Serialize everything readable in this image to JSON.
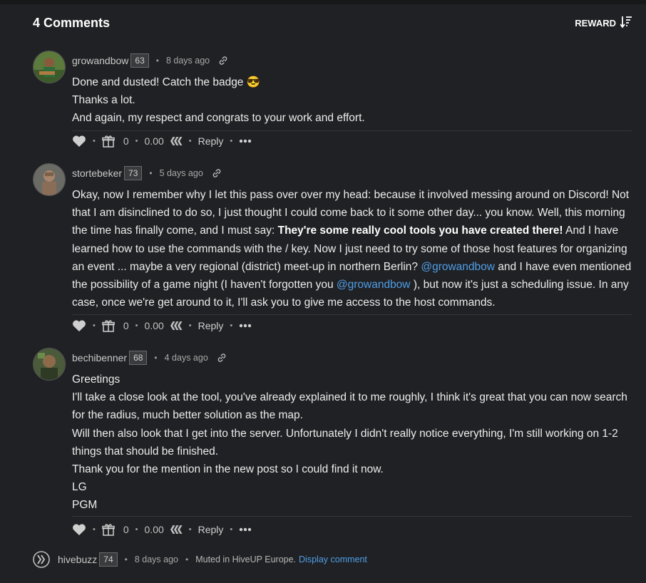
{
  "header": {
    "title": "4 Comments",
    "reward_label": "REWARD"
  },
  "comments": [
    {
      "author": "growandbow",
      "reputation": "63",
      "time": "8 days ago",
      "lines": [
        "Done and dusted! Catch the badge 😎",
        "Thanks a lot.",
        "And again, my respect and congrats to your work and effort."
      ],
      "votes": "0",
      "payout": "0.00",
      "reply": "Reply"
    },
    {
      "author": "stortebeker",
      "reputation": "73",
      "time": "5 days ago",
      "text": {
        "p1": "Okay, now I remember why I let this pass over over my head: because it involved messing around on Discord! Not that I am disinclined to do so, I just thought I could come back to it some other day... you know. Well, this morning the time has finally come, and I must say: ",
        "bold": "They're some really cool tools you have created there!",
        "p2": " And I have learned how to use the commands with the / key. Now I just need to try some of those host features for organizing an event ... maybe a very regional (district) meet-up in northern Berlin? ",
        "mention1": "@growandbow",
        "p3": " and I have even mentioned the possibility of a game night (I haven't forgotten you ",
        "mention2": "@growandbow",
        "p4": " ), but now it's just a scheduling issue. In any case, once we're get around to it, I'll ask you to give me access to the host commands."
      },
      "votes": "0",
      "payout": "0.00",
      "reply": "Reply"
    },
    {
      "author": "bechibenner",
      "reputation": "68",
      "time": "4 days ago",
      "lines": [
        "Greetings",
        "I'll take a close look at the tool, you've already explained it to me roughly, I think it's great that you can now search for the radius, much better solution as the map.",
        "Will then also look that I get into the server. Unfortunately I didn't really notice everything, I'm still working on 1-2 things that should be finished.",
        "Thank you for the mention in the new post so I could find it now.",
        "LG",
        "PGM"
      ],
      "votes": "0",
      "payout": "0.00",
      "reply": "Reply"
    }
  ],
  "muted_comment": {
    "author": "hivebuzz",
    "reputation": "74",
    "time": "8 days ago",
    "message": "Muted in HiveUP Europe.",
    "action": "Display comment"
  },
  "colors": {
    "background": "#202124",
    "link": "#4f9fe8",
    "text": "#ececec"
  },
  "icons": [
    "sort-icon",
    "link-icon",
    "heart-icon",
    "gift-icon",
    "hive-icon",
    "more-icon"
  ]
}
